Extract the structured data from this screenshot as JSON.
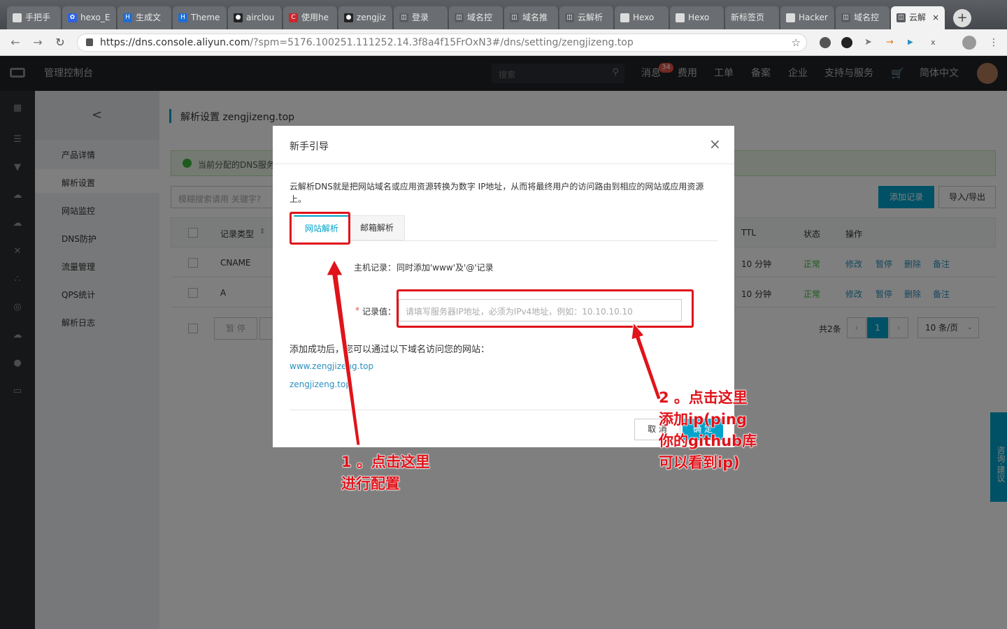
{
  "browser": {
    "tabs": [
      {
        "label": "手把手",
        "icon": "page-icon"
      },
      {
        "label": "hexo_E",
        "icon": "baidu-icon"
      },
      {
        "label": "生成文",
        "icon": "h-icon"
      },
      {
        "label": "Theme",
        "icon": "h-icon"
      },
      {
        "label": "airclou",
        "icon": "github-icon"
      },
      {
        "label": "使用he",
        "icon": "csdn-icon"
      },
      {
        "label": "zengjiz",
        "icon": "github-icon"
      },
      {
        "label": "登录",
        "icon": "aliyun-icon"
      },
      {
        "label": "域名控",
        "icon": "aliyun-icon"
      },
      {
        "label": "域名推",
        "icon": "aliyun-icon"
      },
      {
        "label": "云解析",
        "icon": "aliyun-icon"
      },
      {
        "label": "Hexo",
        "icon": "page-icon"
      },
      {
        "label": "Hexo",
        "icon": "page-icon"
      },
      {
        "label": "新标签页",
        "icon": ""
      },
      {
        "label": "Hacker",
        "icon": "page-icon"
      },
      {
        "label": "域名控",
        "icon": "aliyun-icon"
      },
      {
        "label": "云解",
        "icon": "aliyun-icon",
        "active": true
      }
    ],
    "tab_close": "×",
    "new_tab": "+",
    "url_host": "https://dns.console.aliyun.com",
    "url_rest": "/?spm=5176.100251.111252.14.3f8a4f15FrOxN3#/dns/setting/zengjizeng.top"
  },
  "console": {
    "logo_text": "管理控制台",
    "search_placeholder": "搜索",
    "nav": {
      "messages": "消息",
      "badge": "34",
      "fees": "费用",
      "tickets": "工单",
      "beian": "备案",
      "enterprise": "企业",
      "support": "支持与服务",
      "lang": "简体中文"
    }
  },
  "subnav": {
    "back": "<",
    "items": [
      "产品详情",
      "解析设置",
      "网站监控",
      "DNS防护",
      "流量管理",
      "QPS统计",
      "解析日志"
    ]
  },
  "page": {
    "title": "解析设置 zengjizeng.top",
    "alert": "当前分配的DNS服务",
    "search_placeholder": "模糊搜索请用 关键字?",
    "add_record": "添加记录",
    "import_export": "导入/导出",
    "table_headers": {
      "type": "记录类型",
      "ttl": "TTL",
      "status": "状态",
      "ops": "操作"
    },
    "rows": [
      {
        "type": "CNAME",
        "ttl": "10 分钟",
        "status": "正常",
        "ops": [
          "修改",
          "暂停",
          "删除",
          "备注"
        ]
      },
      {
        "type": "A",
        "ttl": "10 分钟",
        "status": "正常",
        "ops": [
          "修改",
          "暂停",
          "删除",
          "备注"
        ]
      }
    ],
    "pause_btn": "暂 停",
    "total": "共2条",
    "page_num": "1",
    "page_size": "10 条/页",
    "side_widget": "咨询·建议"
  },
  "modal": {
    "title": "新手引导",
    "close": "×",
    "intro": "云解析DNS就是把网站域名或应用资源转换为数字 IP地址，从而将最终用户的访问路由到相应的网站或应用资源上。",
    "tabs": [
      "网站解析",
      "邮箱解析"
    ],
    "host_label": "主机记录：",
    "host_value": "同时添加'www'及'@'记录",
    "value_required": "*",
    "value_label": "记录值：",
    "value_placeholder": "请填写服务器IP地址，必须为IPv4地址，例如：10.10.10.10",
    "success_text": "添加成功后，您可以通过以下域名访问您的网站：",
    "links": [
      "www.zengjizeng.top",
      "zengjizeng.top"
    ],
    "cancel": "取 消",
    "confirm": "确 定"
  },
  "annotations": {
    "note1": [
      "1 。点击这里",
      "进行配置"
    ],
    "note2": [
      "2 。点击这里",
      "添加ip(ping",
      "你的github库",
      "可以看到ip)"
    ]
  },
  "colors": {
    "accent": "#00a2ca",
    "annotation": "#e0131a",
    "success": "#3db63d",
    "link": "#2a8fbd"
  }
}
